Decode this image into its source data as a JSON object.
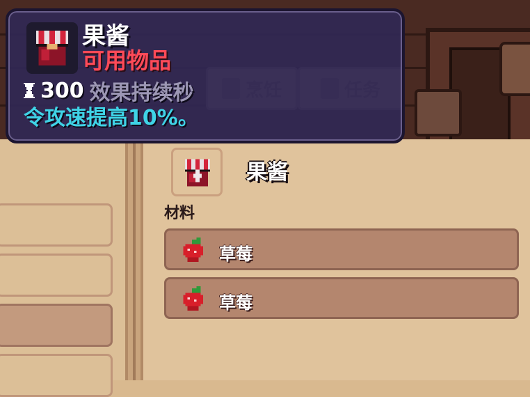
{
  "tooltip": {
    "item_name": "果酱",
    "item_type": "可用物品",
    "duration_value": "300",
    "duration_label": "效果持续秒",
    "effect": "令攻速提高10%。",
    "icon": "jam-jar-icon"
  },
  "background": {
    "tabs": [
      {
        "label": "烹饪",
        "icon": "cooking-icon"
      },
      {
        "label": "任务",
        "icon": "quest-scroll-icon"
      }
    ]
  },
  "recipe": {
    "result_name": "果酱",
    "result_icon": "jam-jar-icon",
    "materials_label": "材料",
    "materials": [
      {
        "name": "草莓",
        "icon": "strawberry-icon"
      },
      {
        "name": "草莓",
        "icon": "strawberry-icon"
      }
    ]
  },
  "colors": {
    "tooltip_bg": "#302854",
    "item_type": "#ff4a58",
    "effect": "#3fd3e6",
    "panel": "#e0c39c",
    "ingredient_row": "#b4866e"
  }
}
